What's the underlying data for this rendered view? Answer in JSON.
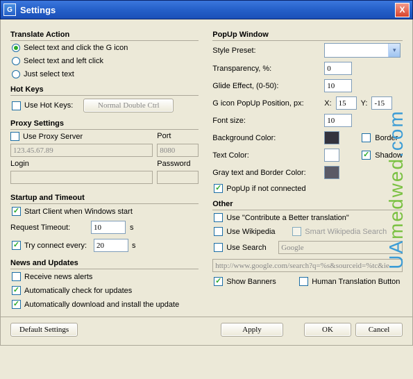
{
  "window": {
    "title": "Settings",
    "close": "X"
  },
  "left": {
    "translate": {
      "heading": "Translate Action",
      "opt1": "Select text and click the G icon",
      "opt2": "Select text and left click",
      "opt3": "Just select text"
    },
    "hotkeys": {
      "heading": "Hot Keys",
      "use": "Use Hot Keys:",
      "value": "Normal Double Ctrl"
    },
    "proxy": {
      "heading": "Proxy Settings",
      "use": "Use Proxy Server",
      "port_label": "Port",
      "host": "123.45.67.89",
      "port": "8080",
      "login_label": "Login",
      "password_label": "Password",
      "login": "",
      "password": ""
    },
    "startup": {
      "heading": "Startup and Timeout",
      "start_client": "Start Client when Windows start",
      "request_timeout": "Request Timeout:",
      "request_timeout_val": "10",
      "seconds": "s",
      "try_connect": "Try connect every:",
      "try_connect_val": "20"
    },
    "news": {
      "heading": "News and Updates",
      "receive": "Receive news alerts",
      "check": "Automatically check for updates",
      "download": "Automatically download and install the update"
    }
  },
  "right": {
    "popup": {
      "heading": "PopUp Window",
      "style_preset": "Style Preset:",
      "transparency": "Transparency, %:",
      "transparency_val": "0",
      "glide": "Glide Effect, (0-50):",
      "glide_val": "10",
      "gicon": "G icon PopUp Position, px:",
      "x_label": "X:",
      "x_val": "15",
      "y_label": "Y:",
      "y_val": "-15",
      "font_size": "Font size:",
      "font_size_val": "10",
      "bg_color": "Background Color:",
      "text_color": "Text Color:",
      "gray_color": "Gray text and Border Color:",
      "border": "Border",
      "shadow": "Shadow",
      "popup_not_connected": "PopUp if not connected",
      "colors": {
        "bg": "#33333e",
        "text": "#ffffff",
        "gray": "#5a5a66"
      }
    },
    "other": {
      "heading": "Other",
      "contribute": "Use \"Contribute a Better translation\"",
      "wikipedia": "Use Wikipedia",
      "smart_wiki": "Smart Wikipedia Search",
      "use_search": "Use Search",
      "search_val": "Google",
      "search_url": "http://www.google.com/search?q=%s&sourceid=%tc&ie",
      "show_banners": "Show Banners",
      "human_trans": "Human Translation Button"
    }
  },
  "footer": {
    "default": "Default Settings",
    "apply": "Apply",
    "ok": "OK",
    "cancel": "Cancel"
  }
}
